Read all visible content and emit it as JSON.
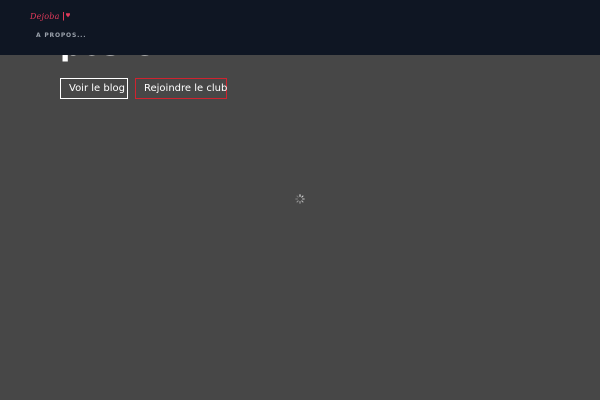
{
  "navbar": {
    "logo_text": "Dejoba",
    "menu_item": "A PROPOS..."
  },
  "hero": {
    "title": "postcm",
    "buttons": {
      "blog_label": "Voir le blog",
      "club_label": "Rejoindre le club"
    }
  },
  "colors": {
    "page_background": "#474747",
    "navbar_background": "#0f1623",
    "logo_color": "#e03a5a",
    "club_button_border": "#d0232f"
  },
  "icons": {
    "logo_mark": "flag-heart-icon",
    "loading": "loading-spinner-icon"
  }
}
